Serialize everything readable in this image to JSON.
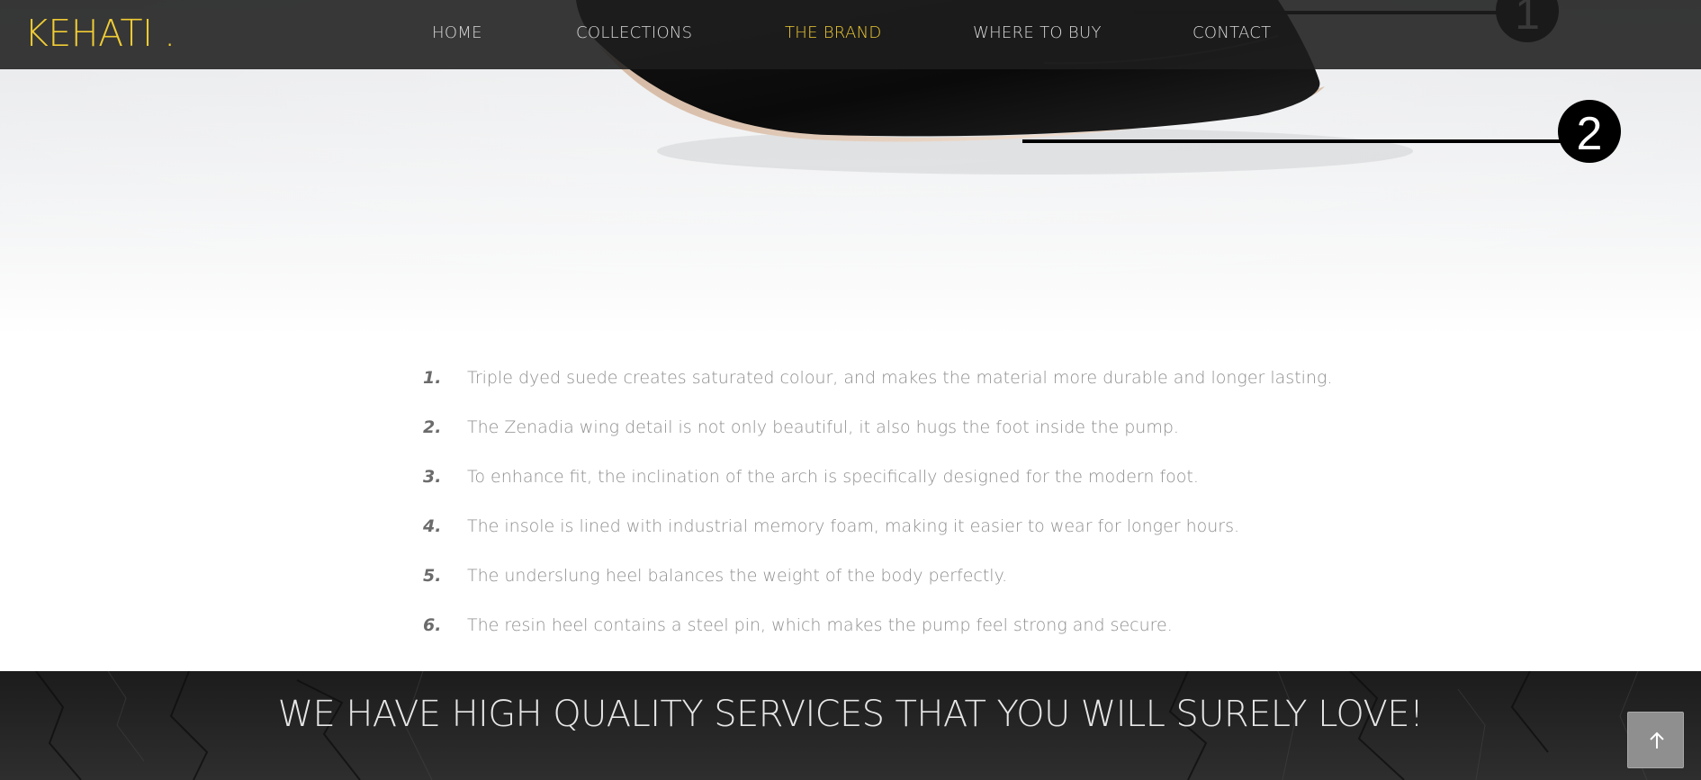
{
  "colors": {
    "accent": "#f0cc34",
    "nav_text": "#d9d9d9",
    "navbar_bg": "#1e1e1e",
    "list_text": "#8e8e8e",
    "list_number": "#6b6b6b",
    "banner_text": "#e6e6e6"
  },
  "header": {
    "logo": "KEHATI .",
    "nav": [
      {
        "label": "HOME",
        "active": false
      },
      {
        "label": "COLLECTIONS",
        "active": false
      },
      {
        "label": "THE BRAND",
        "active": true
      },
      {
        "label": "WHERE TO BUY",
        "active": false
      },
      {
        "label": "CONTACT",
        "active": false
      }
    ]
  },
  "hero": {
    "image": "black-leather-pump-shoe",
    "callouts": [
      "1",
      "2"
    ]
  },
  "features": [
    {
      "number": "1.",
      "text": "Triple dyed suede creates saturated colour, and makes the material more durable and longer lasting."
    },
    {
      "number": "2.",
      "text": "The Zenadia wing detail is not only beautiful, it also hugs the foot inside the pump."
    },
    {
      "number": "3.",
      "text": "To enhance fit, the inclination of the arch is specifically designed for the modern foot."
    },
    {
      "number": "4.",
      "text": "The insole is lined with industrial memory foam, making it easier to wear for longer hours."
    },
    {
      "number": "5.",
      "text": "The underslung heel balances the weight of the body perfectly."
    },
    {
      "number": "6.",
      "text": "The resin heel contains a steel pin, which makes the pump feel strong and secure."
    }
  ],
  "banner": {
    "heading": "WE HAVE HIGH QUALITY SERVICES THAT YOU WILL SURELY LOVE!"
  },
  "back_to_top": {
    "icon": "arrow-up-icon"
  }
}
